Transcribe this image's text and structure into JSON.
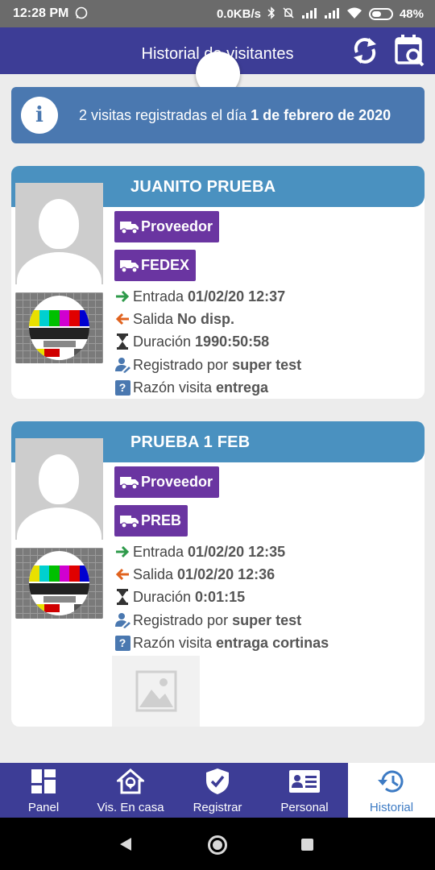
{
  "status_bar": {
    "time": "12:28 PM",
    "network_speed": "0.0KB/s",
    "battery": "48%"
  },
  "app_bar": {
    "title": "Historial de visitantes",
    "refresh_icon": "refresh-icon",
    "calendar_icon": "calendar-search-icon"
  },
  "info_banner": {
    "icon": "info-icon",
    "text_prefix": "2 visitas registradas  el día ",
    "date": "1 de febrero de 2020"
  },
  "visits": [
    {
      "name": "JUANITO PRUEBA",
      "tags": [
        "Proveedor",
        "FEDEX"
      ],
      "entry_label": "Entrada",
      "entry_value": "01/02/20 12:37",
      "exit_label": "Salida",
      "exit_value": "No disp.",
      "duration_label": "Duración",
      "duration_value": "1990:50:58",
      "registered_label": "Registrado por",
      "registered_value": "super test",
      "reason_label": "Razón visita",
      "reason_value": "entrega"
    },
    {
      "name": "PRUEBA 1 FEB",
      "tags": [
        "Proveedor",
        "PREB"
      ],
      "entry_label": "Entrada",
      "entry_value": "01/02/20 12:35",
      "exit_label": "Salida",
      "exit_value": "01/02/20 12:36",
      "duration_label": "Duración",
      "duration_value": "0:01:15",
      "registered_label": "Registrado por",
      "registered_value": "super test",
      "reason_label": "Razón visita",
      "reason_value": "entraga cortinas"
    }
  ],
  "bottom_nav": [
    {
      "label": "Panel",
      "icon": "dashboard-icon"
    },
    {
      "label": "Vis. En casa",
      "icon": "home-location-icon"
    },
    {
      "label": "Registrar",
      "icon": "shield-check-icon"
    },
    {
      "label": "Personal",
      "icon": "id-card-icon"
    },
    {
      "label": "Historial",
      "icon": "history-icon",
      "active": true
    }
  ],
  "colors": {
    "app_bar": "#3d3d96",
    "info_banner": "#4a78b0",
    "card_header": "#4a91c0",
    "tag": "#6a35a1",
    "entry_arrow": "#2e9a4a",
    "exit_arrow": "#e0621e",
    "active_nav": "#3d7bc4"
  }
}
